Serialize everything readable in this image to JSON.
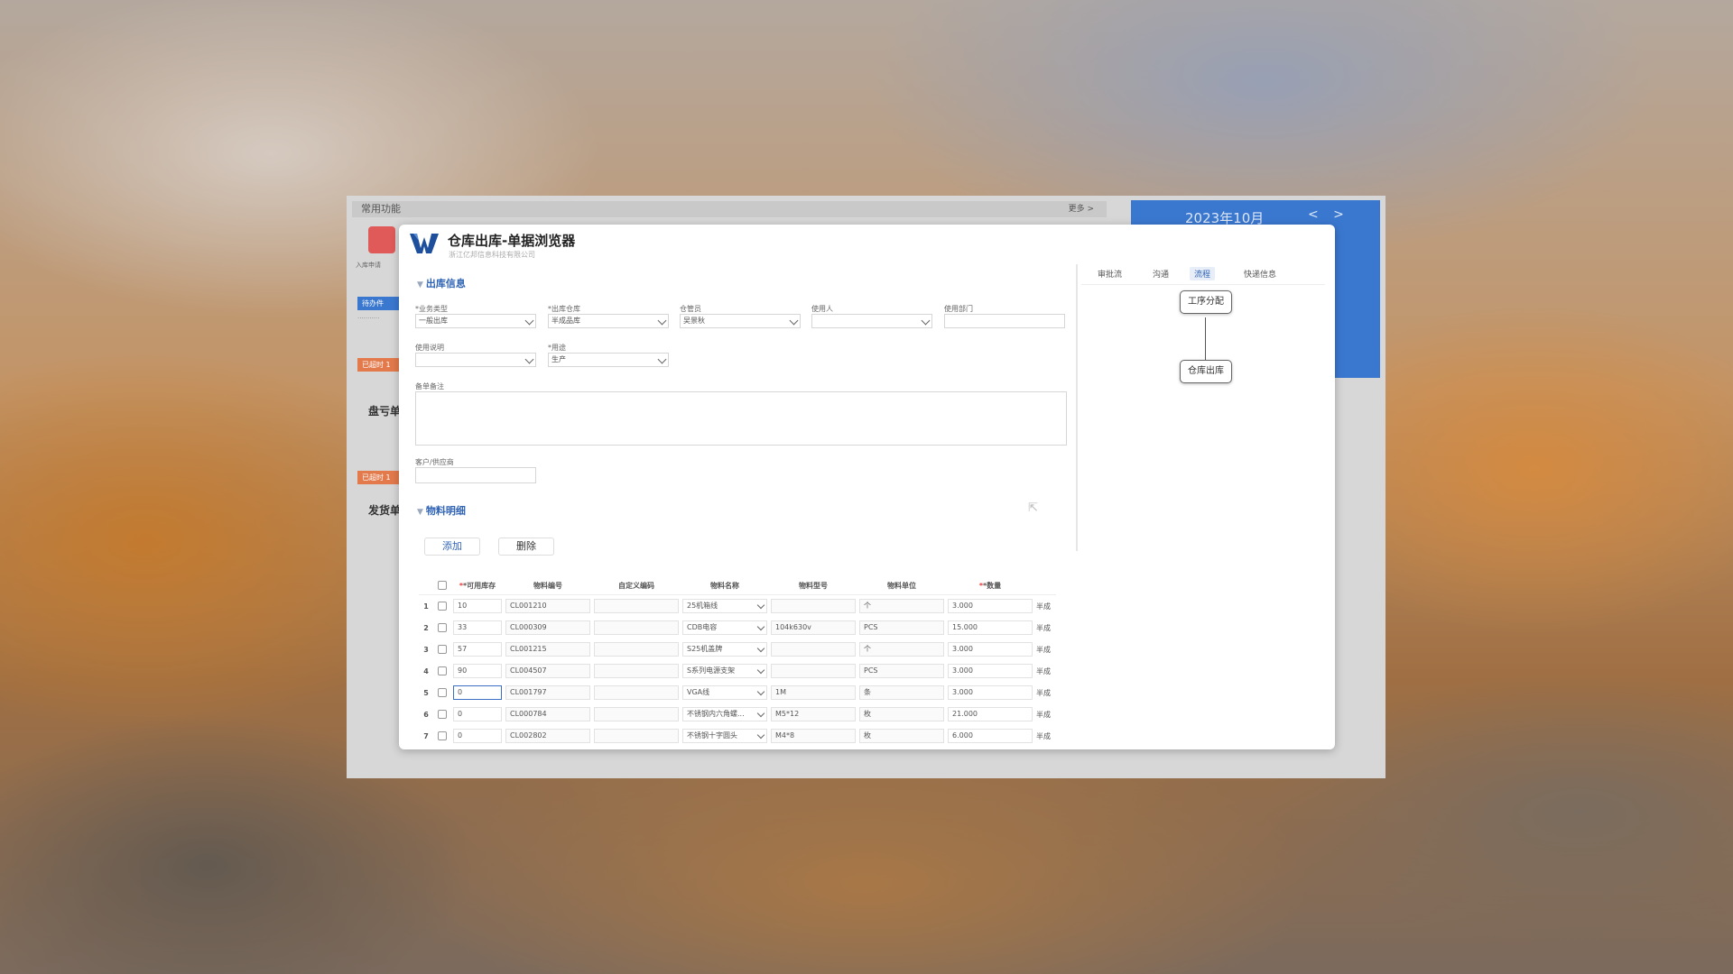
{
  "background_portal": {
    "common_functions": "常用功能",
    "more": "更多 >",
    "calendar_title": "2023年10月",
    "calendar_nav": "< >",
    "card_caption": "入库申请",
    "pending_tab": "待办件",
    "overdue_1": "已超时 1",
    "overdue_2": "已超时 1",
    "item_1": "盘亏单",
    "item_2": "发货单"
  },
  "dialog": {
    "title": "仓库出库-单据浏览器",
    "company": "浙江亿邦信息科技有限公司"
  },
  "outbound_section": {
    "title": "出库信息",
    "fields": {
      "business_type": {
        "label": "*业务类型",
        "value": "一般出库"
      },
      "warehouse": {
        "label": "*出库仓库",
        "value": "半成品库"
      },
      "keeper": {
        "label": "仓管员",
        "value": "吴景秋"
      },
      "user": {
        "label": "使用人",
        "value": ""
      },
      "department": {
        "label": "使用部门",
        "value": ""
      },
      "usage_note": {
        "label": "使用说明",
        "value": ""
      },
      "purpose": {
        "label": "*用途",
        "value": "生产"
      },
      "remark": {
        "label": "备单备注",
        "value": ""
      },
      "customer": {
        "label": "客户/供应商",
        "value": ""
      }
    }
  },
  "materials_section": {
    "title": "物料明细",
    "add_label": "添加",
    "delete_label": "删除",
    "columns": [
      "*可用库存",
      "物料编号",
      "自定义编码",
      "物料名称",
      "物料型号",
      "物料单位",
      "*数量",
      ""
    ],
    "rows": [
      {
        "no": "1",
        "stock": "10",
        "code": "CL001210",
        "custom": "",
        "name": "25机箱线",
        "model": "",
        "unit": "个",
        "qty": "3.000",
        "extra": "半成"
      },
      {
        "no": "2",
        "stock": "33",
        "code": "CL000309",
        "custom": "",
        "name": "CDB电容",
        "model": "104k630v",
        "unit": "PCS",
        "qty": "15.000",
        "extra": "半成"
      },
      {
        "no": "3",
        "stock": "57",
        "code": "CL001215",
        "custom": "",
        "name": "S25机盖牌",
        "model": "",
        "unit": "个",
        "qty": "3.000",
        "extra": "半成"
      },
      {
        "no": "4",
        "stock": "90",
        "code": "CL004507",
        "custom": "",
        "name": "S系列电源支架",
        "model": "",
        "unit": "PCS",
        "qty": "3.000",
        "extra": "半成"
      },
      {
        "no": "5",
        "stock": "0",
        "code": "CL001797",
        "custom": "",
        "name": "VGA线",
        "model": "1M",
        "unit": "条",
        "qty": "3.000",
        "extra": "半成"
      },
      {
        "no": "6",
        "stock": "0",
        "code": "CL000784",
        "custom": "",
        "name": "不锈钢内六角螺...",
        "model": "M5*12",
        "unit": "枚",
        "qty": "21.000",
        "extra": "半成"
      },
      {
        "no": "7",
        "stock": "0",
        "code": "CL002802",
        "custom": "",
        "name": "不锈钢十字圆头",
        "model": "M4*8",
        "unit": "枚",
        "qty": "6.000",
        "extra": "半成"
      }
    ]
  },
  "side_panel": {
    "tabs": [
      "审批流",
      "沟通",
      "流程",
      "快递信息"
    ],
    "active_tab": "流程",
    "flow_nodes": [
      "工序分配",
      "仓库出库"
    ]
  },
  "colors": {
    "accent": "#2f63b4",
    "calendar": "#3a78d0",
    "overdue": "#e37a4b"
  }
}
